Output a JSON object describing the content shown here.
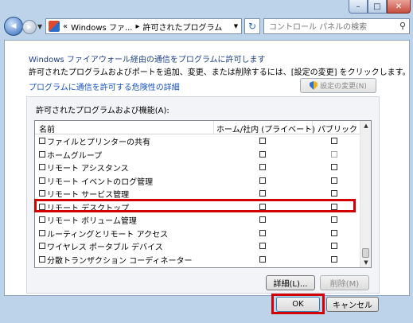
{
  "titlebar": {
    "min_glyph": "–",
    "max_glyph": "□",
    "close_glyph": "✕"
  },
  "nav": {
    "back_glyph": "◀",
    "fwd_glyph": "▶",
    "address": {
      "prefix": "«",
      "crumb1": "Windows ファ...",
      "sep": "▸",
      "crumb2": "許可されたプログラム"
    },
    "search_placeholder": "コントロール パネルの検索"
  },
  "page": {
    "title": "Windows ファイアウォール経由の通信をプログラムに許可します",
    "description": "許可されたプログラムおよびポートを追加、変更、または削除するには、[設定の変更] をクリックします。",
    "risk_link": "プログラムに通信を許可する危険性の詳細",
    "settings_button": "設定の変更(N)"
  },
  "programs": {
    "group_label": "許可されたプログラムおよび機能(A):",
    "columns": {
      "name": "名前",
      "home": "ホーム/社内 (プライベート)",
      "public": "パブリック"
    },
    "rows": [
      {
        "name": "ファイルとプリンターの共有",
        "checked": false,
        "home": false,
        "public": false
      },
      {
        "name": "ホームグループ",
        "checked": false,
        "home": false,
        "public": false,
        "public_dim": true
      },
      {
        "name": "リモート アシスタンス",
        "checked": false,
        "home": false,
        "public": false
      },
      {
        "name": "リモート イベントのログ管理",
        "checked": false,
        "home": false,
        "public": false
      },
      {
        "name": "リモート サービス管理",
        "checked": false,
        "home": false,
        "public": false
      },
      {
        "name": "リモート デスクトップ",
        "checked": false,
        "home": false,
        "public": false
      },
      {
        "name": "リモート ボリューム管理",
        "checked": false,
        "home": false,
        "public": false
      },
      {
        "name": "ルーティングとリモート アクセス",
        "checked": false,
        "home": false,
        "public": false
      },
      {
        "name": "ワイヤレス ポータブル デバイス",
        "checked": false,
        "home": false,
        "public": false
      },
      {
        "name": "分散トランザクション コーディネーター",
        "checked": false,
        "home": false,
        "public": false
      }
    ],
    "details_button": "詳細(L)...",
    "remove_button": "削除(M)"
  },
  "footer": {
    "ok_button": "OK",
    "cancel_button": "キャンセル"
  },
  "colors": {
    "highlight": "#d20000",
    "title_text": "#1d3f8a",
    "link": "#1a54c6"
  }
}
